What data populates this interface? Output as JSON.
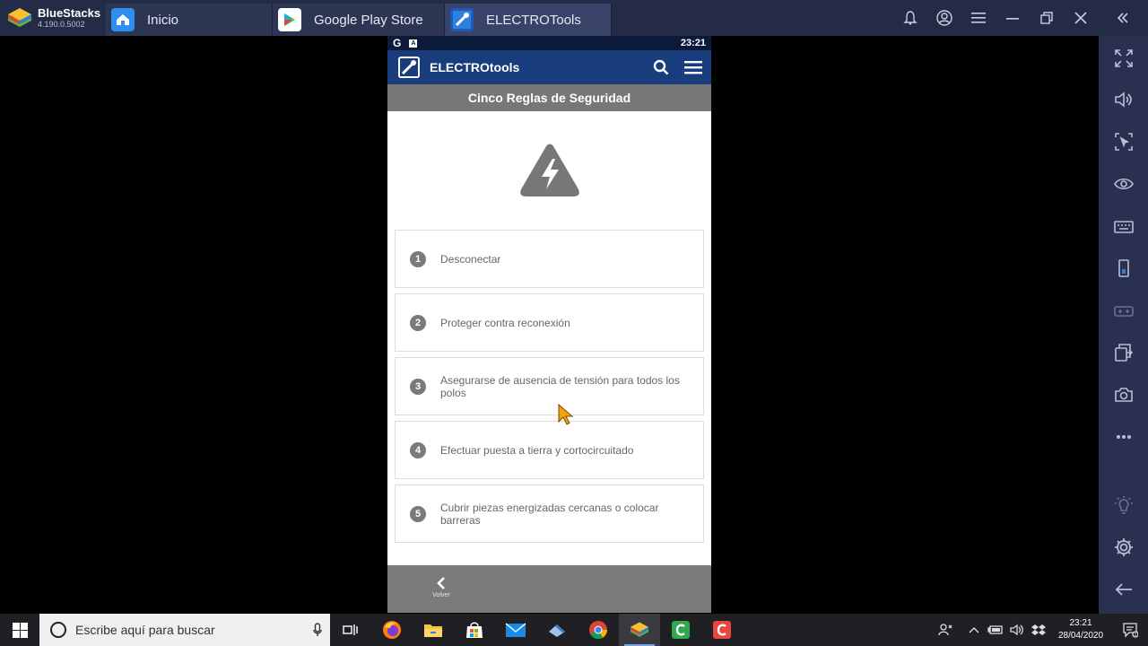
{
  "emulator": {
    "brand_name": "BlueStacks",
    "version": "4.190.0.5002",
    "tabs": [
      {
        "label": "Inicio",
        "icon": "home-icon"
      },
      {
        "label": "Google Play Store",
        "icon": "play-store-icon"
      },
      {
        "label": "ELECTROTools",
        "icon": "electrotools-icon"
      }
    ],
    "window_controls": [
      "bell-icon",
      "account-icon",
      "menu-icon",
      "minimize-icon",
      "restore-icon",
      "close-icon",
      "collapse-icon"
    ],
    "sidebar_icons": [
      "fullscreen-icon",
      "volume-icon",
      "cursor-lock-icon",
      "eye-icon",
      "keyboard-icon",
      "rotate-phone-icon",
      "gamepad-icon",
      "multi-instance-icon",
      "camera-icon",
      "more-icon",
      "brightness-icon",
      "settings-icon",
      "back-icon"
    ]
  },
  "phone": {
    "status_time": "23:21",
    "status_g": "G",
    "app_title": "ELECTROtools",
    "page_title": "Cinco Reglas de Seguridad",
    "rules": [
      {
        "num": "1",
        "text": "Desconectar"
      },
      {
        "num": "2",
        "text": "Proteger contra reconexión"
      },
      {
        "num": "3",
        "text": "Asegurarse de ausencia de tensión para todos los polos"
      },
      {
        "num": "4",
        "text": "Efectuar puesta a tierra y cortocircuitado"
      },
      {
        "num": "5",
        "text": "Cubrir piezas energizadas cercanas o colocar barreras"
      }
    ],
    "back_label": "Volver"
  },
  "taskbar": {
    "search_placeholder": "Escribe aquí para buscar",
    "time": "23:21",
    "date": "28/04/2020"
  },
  "colors": {
    "appbar": "#193c7d",
    "subheader": "#777777",
    "emulator_bar": "#232b47"
  }
}
